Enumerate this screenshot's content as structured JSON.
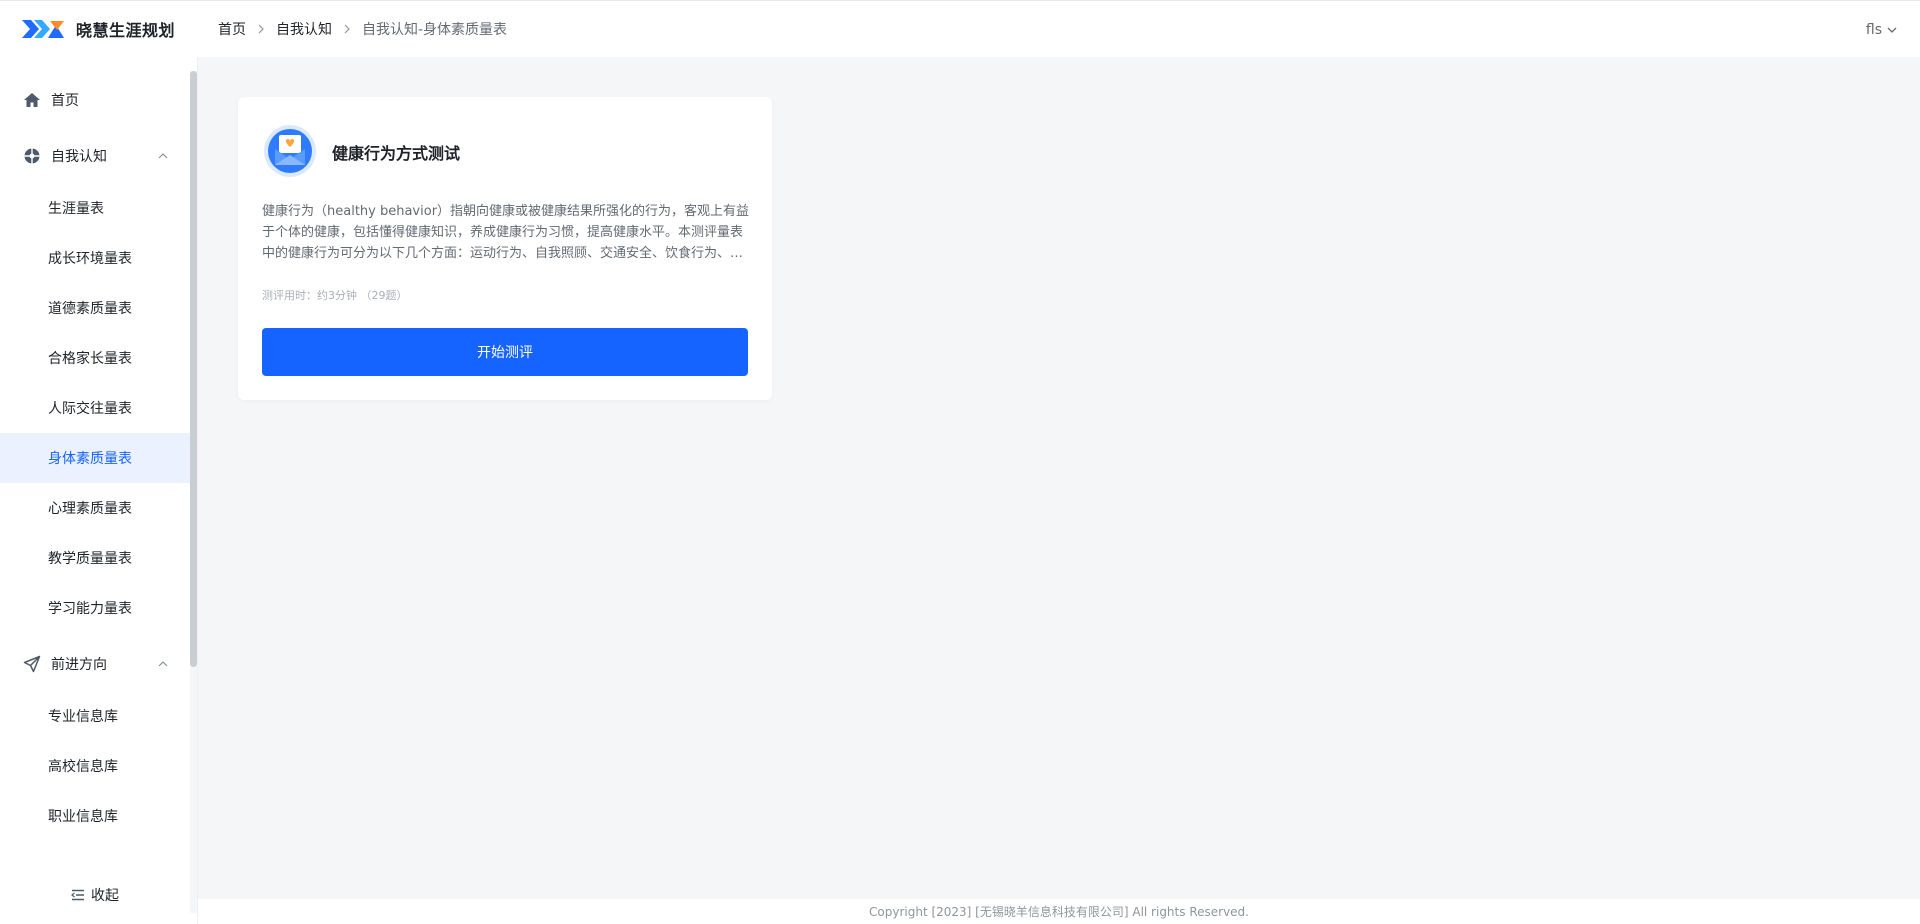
{
  "brand": {
    "name": "晓慧生涯规划"
  },
  "breadcrumb": {
    "items": [
      "首页",
      "自我认知",
      "自我认知-身体素质量表"
    ]
  },
  "user": {
    "name": "fls"
  },
  "sidebar": {
    "home": {
      "label": "首页",
      "icon": "home-icon"
    },
    "group1": {
      "label": "自我认知",
      "icon": "self-awareness-icon",
      "items": [
        "生涯量表",
        "成长环境量表",
        "道德素质量表",
        "合格家长量表",
        "人际交往量表",
        "身体素质量表",
        "心理素质量表",
        "教学质量量表",
        "学习能力量表"
      ],
      "active_index": 5
    },
    "group2": {
      "label": "前进方向",
      "icon": "paper-plane-icon",
      "items": [
        "专业信息库",
        "高校信息库",
        "职业信息库"
      ]
    },
    "collapse_label": "收起"
  },
  "card": {
    "title": "健康行为方式测试",
    "description": "健康行为（healthy behavior）指朝向健康或被健康结果所强化的行为，客观上有益于个体的健康，包括懂得健康知识，养成健康行为习惯，提高健康水平。本测评量表中的健康行为可分为以下几个方面：运动行为、自我照顾、交通安全、饮食行为、压力处理和健康知识。",
    "meta": "测评用时：约3分钟 （29题）",
    "button_label": "开始测评"
  },
  "footer": {
    "copyright": "Copyright [2023] [无锡晓羊信息科技有限公司] All rights Reserved."
  },
  "colors": {
    "primary": "#1664ff",
    "active_bg": "#ebf1ff",
    "main_bg": "#f5f6f8"
  }
}
